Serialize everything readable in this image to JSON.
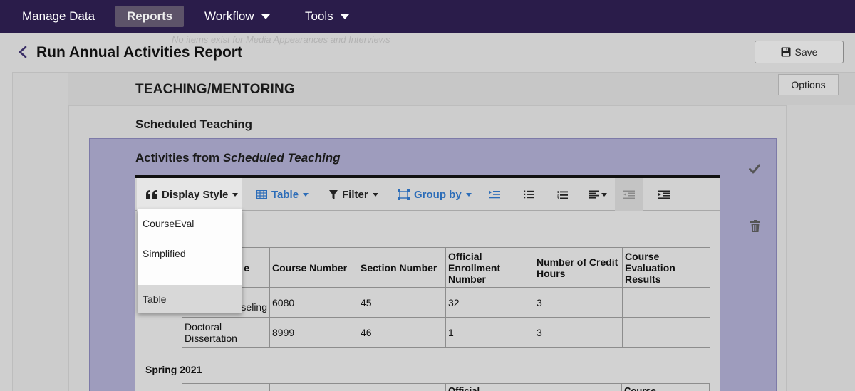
{
  "nav": {
    "items": [
      {
        "label": "Manage Data"
      },
      {
        "label": "Reports"
      },
      {
        "label": "Workflow"
      },
      {
        "label": "Tools"
      }
    ]
  },
  "ghost_note": "No items exist for Media Appearances and Interviews",
  "page": {
    "title": "Run Annual Activities Report",
    "save_label": "Save"
  },
  "section": {
    "title": "TEACHING/MENTORING",
    "options_label": "Options",
    "subsection_title": "Scheduled Teaching",
    "activities_prefix": "Activities from ",
    "activities_source": "Scheduled Teaching"
  },
  "toolbar": {
    "display_style": "Display Style",
    "table": "Table",
    "filter": "Filter",
    "group_by": "Group by"
  },
  "display_style_menu": {
    "options": [
      "CourseEval",
      "Simplified",
      "Table"
    ],
    "selected": "Table"
  },
  "table": {
    "headers": [
      "e",
      "Course Number",
      "Section Number",
      "Official Enrollment Number",
      "Number of Credit Hours",
      "Course Evaluation Results"
    ],
    "rows": [
      [
        "/Cou nseling",
        "6080",
        "45",
        "32",
        "3",
        ""
      ],
      [
        "Doctoral Dissertation",
        "8999",
        "46",
        "1",
        "3",
        ""
      ]
    ]
  },
  "next_term": "Spring 2021",
  "partial_headers": [
    "Official",
    "Course"
  ]
}
